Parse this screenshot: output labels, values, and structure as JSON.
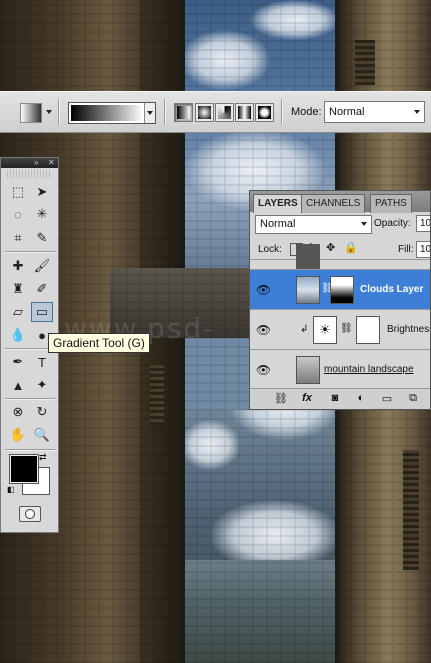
{
  "watermark": "www.psd-",
  "options_bar": {
    "mode_label": "Mode:",
    "mode_value": "Normal",
    "gradient_types": [
      "linear-gradient-icon",
      "radial-gradient-icon",
      "angle-gradient-icon",
      "reflected-gradient-icon",
      "diamond-gradient-icon"
    ]
  },
  "tools_panel": {
    "tooltip": "Gradient Tool (G)",
    "foreground_color": "#000000",
    "background_color": "#ffffff"
  },
  "layers_panel": {
    "tabs": [
      "LAYERS",
      "CHANNELS",
      "PATHS"
    ],
    "blend_mode": "Normal",
    "opacity_label": "Opacity:",
    "opacity_value": "10",
    "lock_label": "Lock:",
    "fill_label": "Fill:",
    "fill_value": "10",
    "layers": [
      {
        "name": "Clouds Layer",
        "selected": true
      },
      {
        "name": "Brightness",
        "selected": false
      },
      {
        "name": "mountain landscape",
        "selected": false
      }
    ]
  }
}
